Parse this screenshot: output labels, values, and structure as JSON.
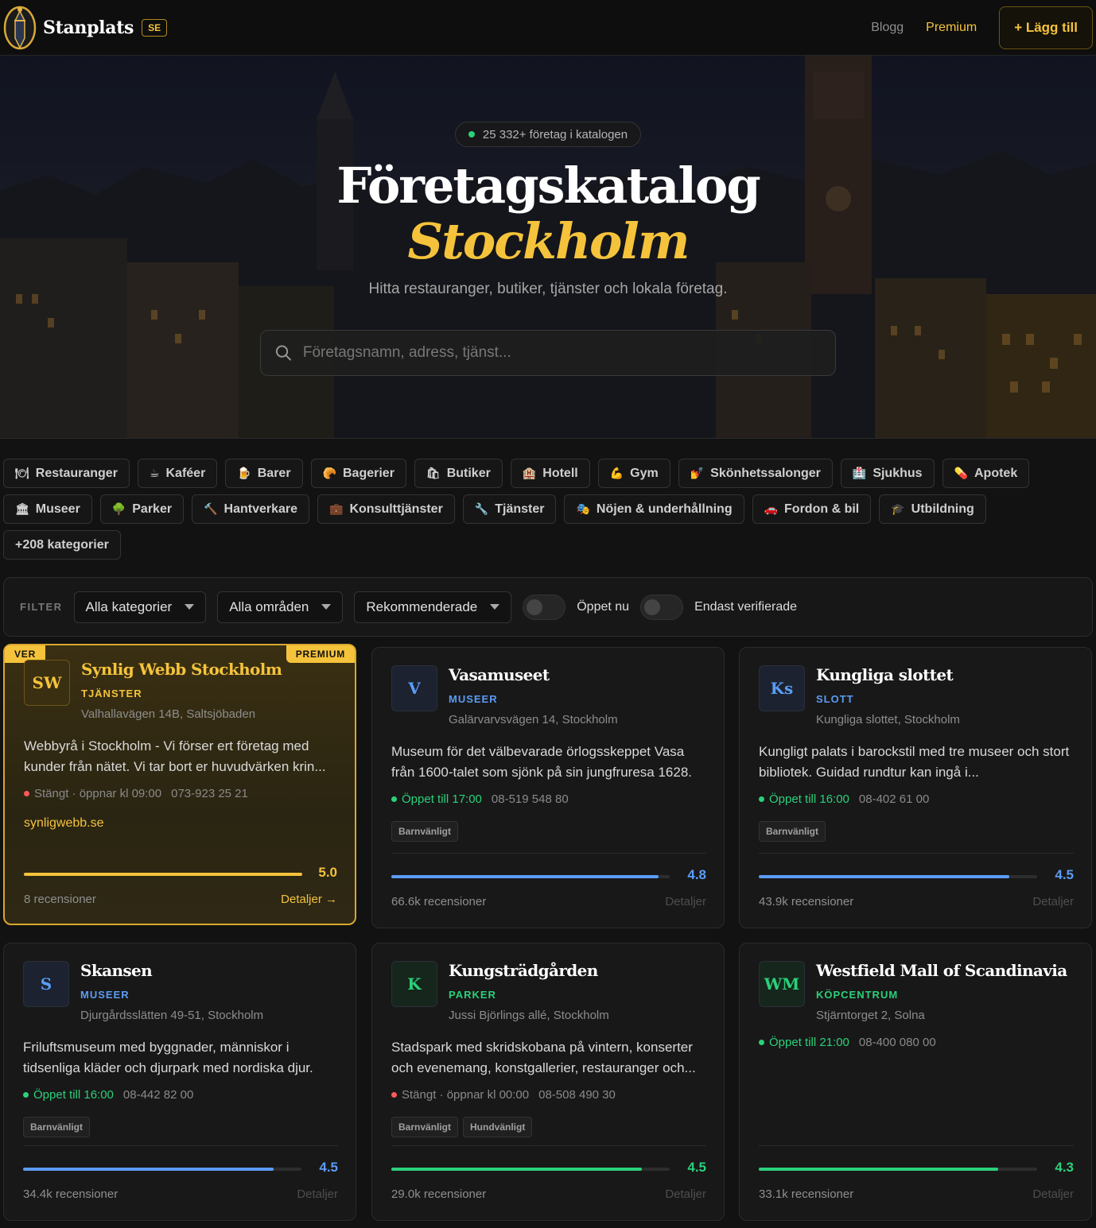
{
  "nav": {
    "brand": "Stanplats",
    "country": "SE",
    "blog": "Blogg",
    "premium": "Premium",
    "add": "+ Lägg till"
  },
  "hero": {
    "count": "25 332+ företag i katalogen",
    "title": "Företagskatalog",
    "city": "Stockholm",
    "subtitle": "Hitta restauranger, butiker, tjänster och lokala företag.",
    "search_placeholder": "Företagsnamn, adress, tjänst..."
  },
  "categories": [
    {
      "icon": "🍽",
      "label": "Restauranger"
    },
    {
      "icon": "☕",
      "label": "Kaféer"
    },
    {
      "icon": "🍺",
      "label": "Barer"
    },
    {
      "icon": "🥐",
      "label": "Bagerier"
    },
    {
      "icon": "🛍",
      "label": "Butiker"
    },
    {
      "icon": "🏨",
      "label": "Hotell"
    },
    {
      "icon": "💪",
      "label": "Gym"
    },
    {
      "icon": "💅",
      "label": "Skönhetssalonger"
    },
    {
      "icon": "🏥",
      "label": "Sjukhus"
    },
    {
      "icon": "💊",
      "label": "Apotek"
    },
    {
      "icon": "🏛",
      "label": "Museer"
    },
    {
      "icon": "🌳",
      "label": "Parker"
    },
    {
      "icon": "🔨",
      "label": "Hantverkare"
    },
    {
      "icon": "💼",
      "label": "Konsulttjänster"
    },
    {
      "icon": "🔧",
      "label": "Tjänster"
    },
    {
      "icon": "🎭",
      "label": "Nöjen & underhållning"
    },
    {
      "icon": "🚗",
      "label": "Fordon & bil"
    },
    {
      "icon": "🎓",
      "label": "Utbildning"
    },
    {
      "icon": "",
      "label": "+208 kategorier"
    }
  ],
  "filter": {
    "label": "FILTER",
    "category": "Alla kategorier",
    "area": "Alla områden",
    "sort": "Rekommenderade",
    "open_now": "Öppet nu",
    "verified_only": "Endast verifierade"
  },
  "colors": {
    "accent": "#f5c33b",
    "blue": "#5b9cf5",
    "green": "#2bd07a",
    "red": "#ff5a5a"
  },
  "listings": [
    {
      "initials": "SW",
      "name": "Synlig Webb Stockholm",
      "category": "TJÄNSTER",
      "address": "Valhallavägen 14B, Saltsjöbaden",
      "description": "Webbyrå i Stockholm - Vi förser ert företag med kunder från nätet. Vi tar bort er huvudvärken krin...",
      "status": "Stängt · öppnar kl 09:00",
      "open": false,
      "phone": "073-923 25 21",
      "website": "synligwebb.se",
      "rating": "5.0",
      "rating_fraction": 1.0,
      "reviews": "8 recensioner",
      "details": "Detaljer →",
      "verified_tag": "VER",
      "premium_tag": "PREMIUM",
      "badges": []
    },
    {
      "initials": "V",
      "name": "Vasamuseet",
      "category": "MUSEER",
      "address": "Galärvarvsvägen 14, Stockholm",
      "description": "Museum för det välbevarade örlogsskeppet Vasa från 1600-talet som sjönk på sin jungfruresa 1628.",
      "status": "Öppet till 17:00",
      "open": true,
      "phone": "08-519 548 80",
      "rating": "4.8",
      "rating_fraction": 0.96,
      "reviews": "66.6k recensioner",
      "details": "Detaljer",
      "badges": [
        "Barnvänligt"
      ]
    },
    {
      "initials": "Ks",
      "name": "Kungliga slottet",
      "category": "SLOTT",
      "address": "Kungliga slottet, Stockholm",
      "description": "Kungligt palats i barockstil med tre museer och stort bibliotek. Guidad rundtur kan ingå i...",
      "status": "Öppet till 16:00",
      "open": true,
      "phone": "08-402 61 00",
      "rating": "4.5",
      "rating_fraction": 0.9,
      "reviews": "43.9k recensioner",
      "details": "Detaljer",
      "badges": [
        "Barnvänligt"
      ]
    },
    {
      "initials": "S",
      "name": "Skansen",
      "category": "MUSEER",
      "address": "Djurgårdsslätten 49-51, Stockholm",
      "description": "Friluftsmuseum med byggnader, människor i tidsenliga kläder och djurpark med nordiska djur.",
      "status": "Öppet till 16:00",
      "open": true,
      "phone": "08-442 82 00",
      "rating": "4.5",
      "rating_fraction": 0.9,
      "reviews": "34.4k recensioner",
      "details": "Detaljer",
      "badges": [
        "Barnvänligt"
      ]
    },
    {
      "initials": "K",
      "name": "Kungsträdgården",
      "category": "PARKER",
      "address": "Jussi Björlings allé, Stockholm",
      "description": "Stadspark med skridskobana på vintern, konserter och evenemang, konstgallerier, restauranger och...",
      "status": "Stängt · öppnar kl 00:00",
      "open": false,
      "phone": "08-508 490 30",
      "rating": "4.5",
      "rating_fraction": 0.9,
      "reviews": "29.0k recensioner",
      "details": "Detaljer",
      "badges": [
        "Barnvänligt",
        "Hundvänligt"
      ]
    },
    {
      "initials": "WM",
      "name": "Westfield Mall of Scandinavia",
      "category": "KÖPCENTRUM",
      "address": "Stjärntorget 2, Solna",
      "description": "",
      "status": "Öppet till 21:00",
      "open": true,
      "phone": "08-400 080 00",
      "rating": "4.3",
      "rating_fraction": 0.86,
      "reviews": "33.1k recensioner",
      "details": "Detaljer",
      "badges": []
    }
  ]
}
